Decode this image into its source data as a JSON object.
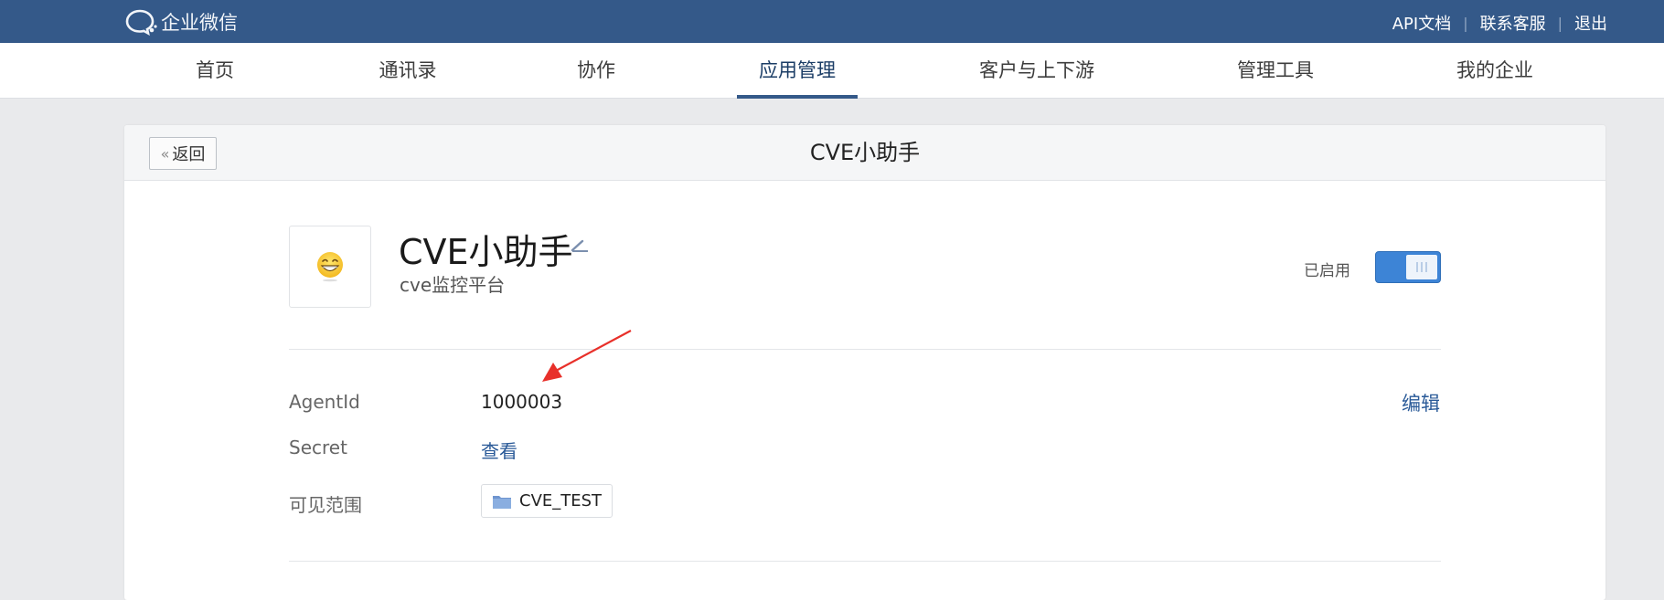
{
  "topbar": {
    "logo_text": "企业微信",
    "links": [
      "API文档",
      "联系客服",
      "退出"
    ],
    "separator": "|"
  },
  "nav": {
    "items": [
      "首页",
      "通讯录",
      "协作",
      "应用管理",
      "客户与上下游",
      "管理工具",
      "我的企业"
    ],
    "active": "应用管理"
  },
  "header": {
    "back_label": "返回",
    "title": "CVE小助手"
  },
  "app": {
    "icon": "grinning-face-icon",
    "icon_glyph": "😁",
    "name": "CVE小助手",
    "description": "cve监控平台",
    "status_label": "已启用",
    "enabled": true
  },
  "details": {
    "agentid_label": "AgentId",
    "agentid_value": "1000003",
    "edit_label": "编辑",
    "secret_label": "Secret",
    "secret_link": "查看",
    "scope_label": "可见范围",
    "scope_value": "CVE_TEST"
  },
  "colors": {
    "topbar": "#345989",
    "accent": "#3d84d6",
    "link": "#2a5a98",
    "annotation_arrow": "#e8302a"
  }
}
